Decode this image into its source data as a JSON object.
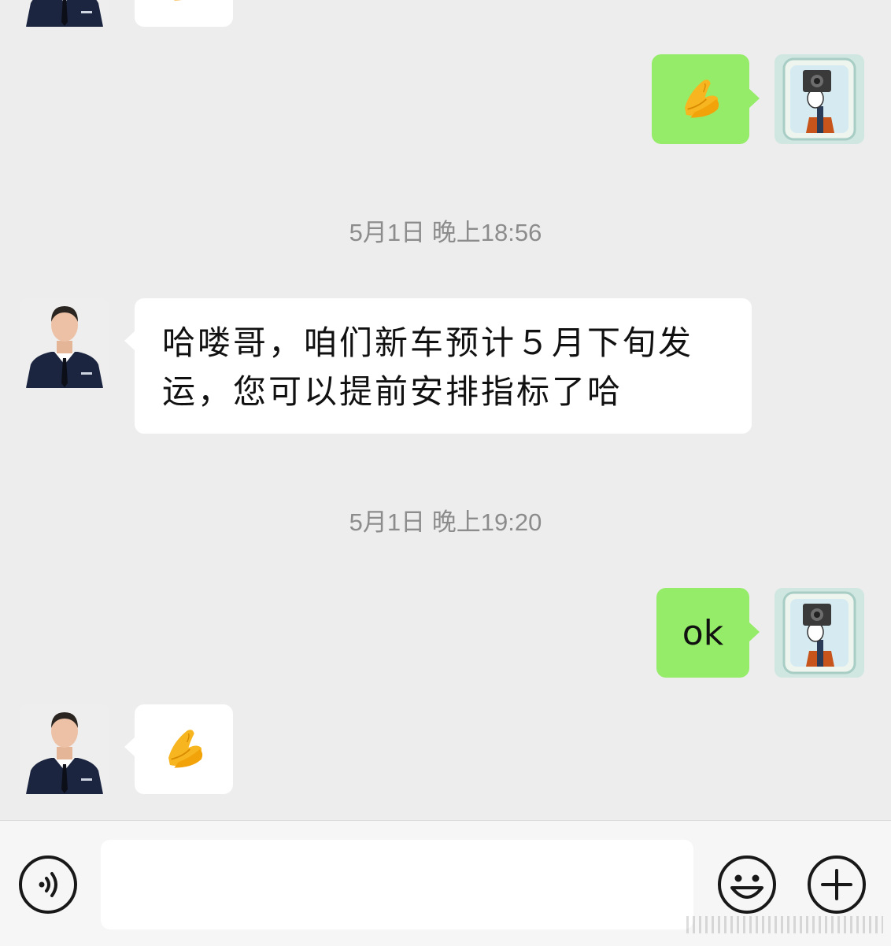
{
  "messages": [
    {
      "from": "contact",
      "type": "emoji",
      "emoji": "folded-hands"
    },
    {
      "from": "me",
      "type": "emoji",
      "emoji": "folded-hands"
    },
    {
      "type": "timestamp",
      "text": "5月1日 晚上18:56"
    },
    {
      "from": "contact",
      "type": "text",
      "lines": [
        "哈喽哥，咱们新车预计５月下旬发",
        "运，您可以提前安排指标了哈"
      ]
    },
    {
      "type": "timestamp",
      "text": "5月1日 晚上19:20"
    },
    {
      "from": "me",
      "type": "text",
      "text": "ok"
    },
    {
      "from": "contact",
      "type": "emoji",
      "emoji": "folded-hands"
    }
  ],
  "input_bar": {
    "voice_icon": "voice-icon",
    "emoji_icon": "smiley-icon",
    "add_icon": "plus-icon",
    "text_value": ""
  },
  "colors": {
    "background": "#ededed",
    "my_bubble": "#95ec69",
    "their_bubble": "#ffffff",
    "timestamp_text": "#8c8c8c"
  }
}
